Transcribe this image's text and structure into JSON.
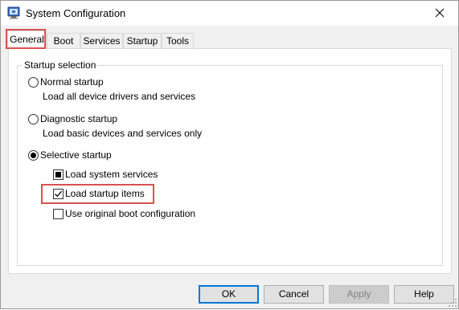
{
  "window": {
    "title": "System Configuration"
  },
  "tabs": [
    {
      "label": "General",
      "selected": true
    },
    {
      "label": "Boot",
      "selected": false
    },
    {
      "label": "Services",
      "selected": false
    },
    {
      "label": "Startup",
      "selected": false
    },
    {
      "label": "Tools",
      "selected": false
    }
  ],
  "startup_selection": {
    "group_label": "Startup selection",
    "options": [
      {
        "label": "Normal startup",
        "description": "Load all device drivers and services",
        "selected": false
      },
      {
        "label": "Diagnostic startup",
        "description": "Load basic devices and services only",
        "selected": false
      },
      {
        "label": "Selective startup",
        "selected": true
      }
    ],
    "checkboxes": [
      {
        "label": "Load system services",
        "state": "indeterminate"
      },
      {
        "label": "Load startup items",
        "state": "checked"
      },
      {
        "label": "Use original boot configuration",
        "state": "unchecked"
      }
    ]
  },
  "buttons": {
    "ok": "OK",
    "cancel": "Cancel",
    "apply": "Apply",
    "help": "Help"
  },
  "colors": {
    "highlight_box": "#d9534f",
    "default_button_border": "#0078d7"
  },
  "icons": {
    "app": "system-configuration-icon",
    "close": "close-icon",
    "resize": "resize-grip-icon"
  }
}
